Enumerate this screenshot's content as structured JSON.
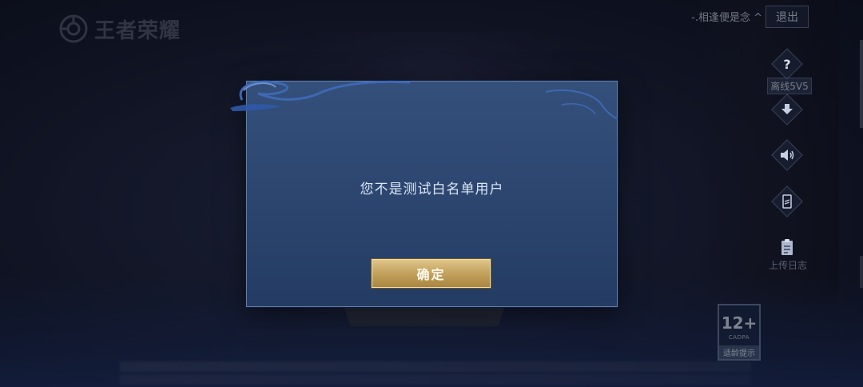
{
  "logo": {
    "text": "王者荣耀"
  },
  "header": {
    "account_name": "-.相逢便是念 ^",
    "logout_label": "退出"
  },
  "side": {
    "help_icon": "question-icon",
    "offline_label": "离线5V5",
    "download_icon": "download-icon",
    "sound_icon": "speaker-icon",
    "card_icon": "card-icon",
    "upload_log_label": "上传日志"
  },
  "age_badge": {
    "rating": "12+",
    "org": "CADPA",
    "tip": "适龄提示"
  },
  "dialog": {
    "message": "您不是测试白名单用户",
    "confirm_label": "确定"
  },
  "colors": {
    "dialog_bg": "#2c4670",
    "confirm_gold": "#c5a461",
    "text": "#dbe6f6"
  }
}
